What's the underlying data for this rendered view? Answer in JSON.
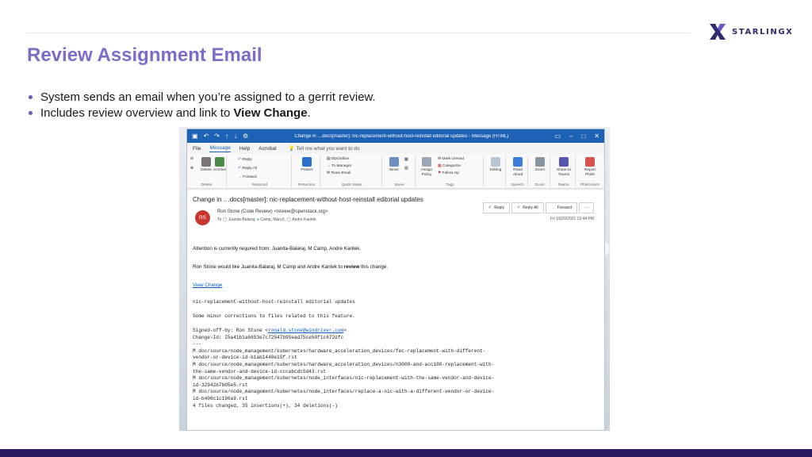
{
  "slide": {
    "title": "Review Assignment Email",
    "bullets": [
      {
        "text": "System sends an email when you’re assigned to a gerrit review."
      },
      {
        "prefix": "Includes review overview and link to ",
        "bold": "View Change",
        "suffix": "."
      }
    ],
    "logo_text": "STARLINGX",
    "colors": {
      "title": "#7f6bc9",
      "bullet": "#6b58c0",
      "footer": "#2b1a5e",
      "logo": "#2d2a6e"
    }
  },
  "outlook": {
    "title": "Change in …docs[master]: nic-replacement-without-host-reinstall editorial updates  -  Message (HTML)",
    "menu": [
      "File",
      "Message",
      "Help",
      "Acrobat"
    ],
    "menu_active": "Message",
    "tell_me": "Tell me what you want to do",
    "ribbon": {
      "delete": "Delete",
      "archive": "Archive",
      "group_delete": "Delete",
      "reply": "Reply",
      "reply_all": "Reply All",
      "forward": "Forward",
      "group_respond": "Respond",
      "protect": "Protect",
      "group_protection": "Protection",
      "quick1": "DlpOutbox",
      "quick2": "To Manager",
      "quick3": "Team Email",
      "group_quick": "Quick Steps",
      "move": "Move",
      "group_move": "Move",
      "assign_policy": "Assign Policy",
      "mark_unread": "Mark Unread",
      "categorize": "Categorize",
      "follow_up": "Follow Up",
      "group_tags": "Tags",
      "editing": "Editing",
      "read_aloud": "Read Aloud",
      "group_speech": "Speech",
      "zoom": "Zoom",
      "group_zoom": "Zoom",
      "share_teams": "Share to Teams",
      "group_teams": "Teams",
      "report_phish": "Report Phish",
      "group_phish": "PhishAlarm"
    },
    "message": {
      "subject": "Change in …docs[master]: nic-replacement-without-host-reinstall editorial updates",
      "avatar": "RS",
      "sender": "Ron Stone (Code Review) <review@openstack.org>",
      "to_label": "To",
      "to": [
        "Juanita-Balaraj;",
        "Camp, MaryX;",
        "Andre Kantek"
      ],
      "actions": [
        "Reply",
        "Reply All",
        "Forward"
      ],
      "date": "Fri 10/29/2021 12:44 PM",
      "attention": "Attention is currently required from: Juanita-Balaraj, M Camp, Andre Kantek.",
      "review_pre": "Ron Stone would like Juanita-Balaraj, M Camp and Andre Kantek to ",
      "review_bold": "review",
      "review_post": " this change.",
      "view_change": "View Change",
      "change_title": "nic-replacement-without-host-reinstall editorial updates",
      "desc": "Some minor corrections to files related to this feature.",
      "signed_pre": "Signed-off-by: Ron Stone <",
      "signed_email": "ronald.stone@windriver.com",
      "signed_post": ">",
      "files": "Change-Id: I5a41b1a6653e7c72547b95ead75ce50f1c672dfc\n---\nM doc/source/node_management/kubernetes/hardware_acceleration_devices/fec-replacement-with-different-\nvendor-or-device-id-b1ab1440e15f.rst\nM doc/source/node_management/kubernetes/hardware_acceleration_devices/n3000-and-acc100-replacement-with-\nthe-same-vendor-and-device-id-cccabcdc5d43.rst\nM doc/source/node_management/kubernetes/node_interfaces/nic-replacement-with-the-same-vendor-and-device-\nid-32942b7b05e5.rst\nM doc/source/node_management/kubernetes/node_interfaces/replace-a-nic-with-a-different-vendor-or-device-\nid-b406c1c190a9.rst\n4 files changed, 35 insertions(+), 34 deletions(-)"
    }
  }
}
